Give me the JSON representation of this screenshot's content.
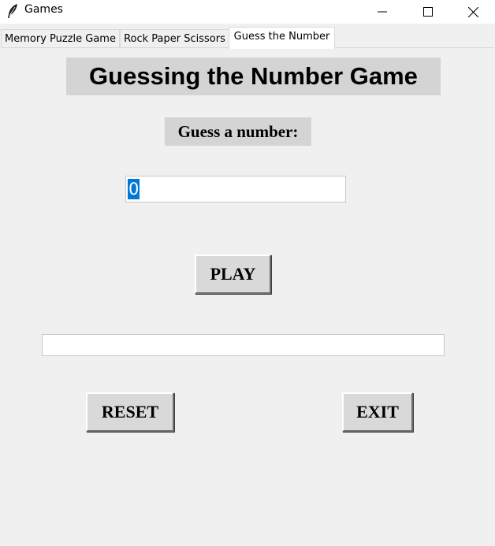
{
  "window": {
    "title": "Games",
    "icon": "feather-icon",
    "controls": [
      "minimize-icon",
      "maximize-icon",
      "close-icon"
    ]
  },
  "tabs": [
    {
      "label": "Memory Puzzle Game",
      "selected": false
    },
    {
      "label": "Rock Paper Scissors",
      "selected": false
    },
    {
      "label": "Guess the Number",
      "selected": true
    }
  ],
  "game": {
    "heading": "Guessing the Number Game",
    "prompt": "Guess a number:",
    "guess_value": "0",
    "result_text": "",
    "play_label": "PLAY",
    "reset_label": "RESET",
    "exit_label": "EXIT"
  },
  "colors": {
    "background": "#f0f0f0",
    "label_background": "#d4d4d4",
    "selection": "#0078d7"
  }
}
